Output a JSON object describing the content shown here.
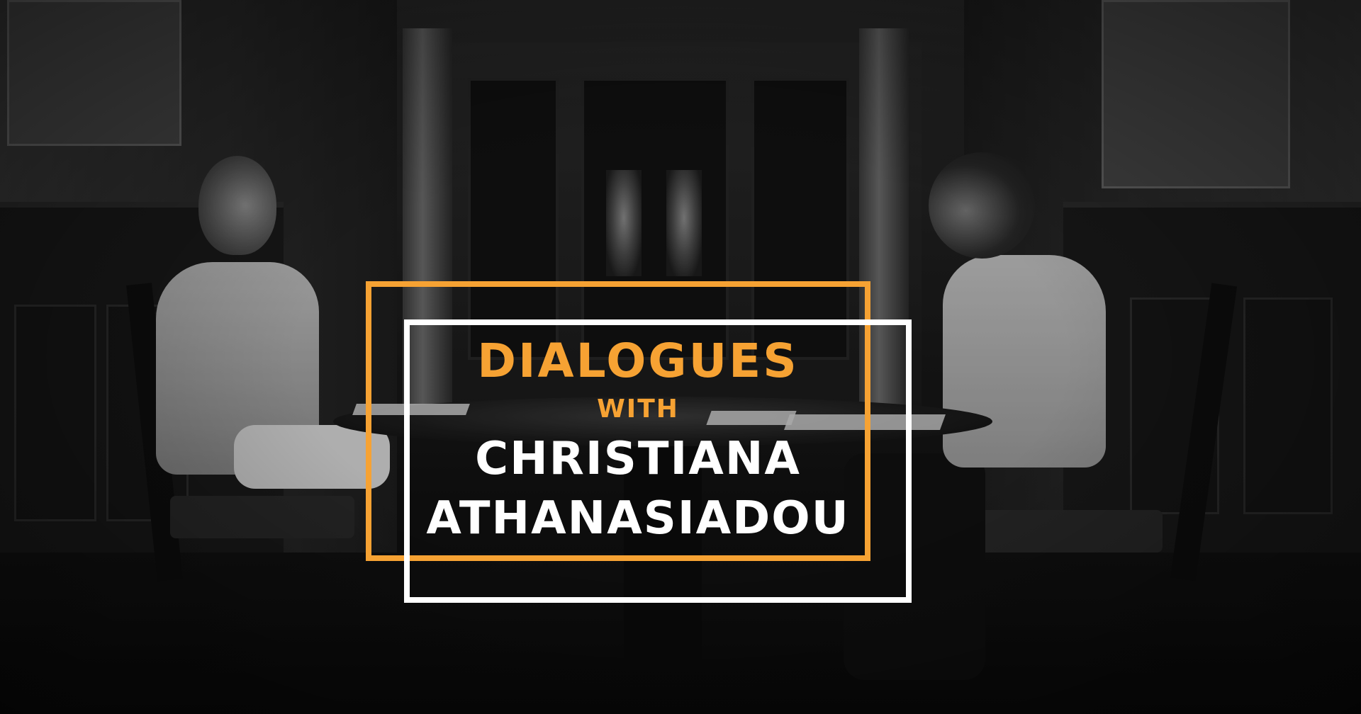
{
  "banner": {
    "line1": "DIALOGUES",
    "line2": "WITH",
    "name_line1": "CHRISTIANA",
    "name_line2": "ATHANASIADOU"
  },
  "colors": {
    "accent": "#f6a233",
    "text_white": "#ffffff"
  }
}
